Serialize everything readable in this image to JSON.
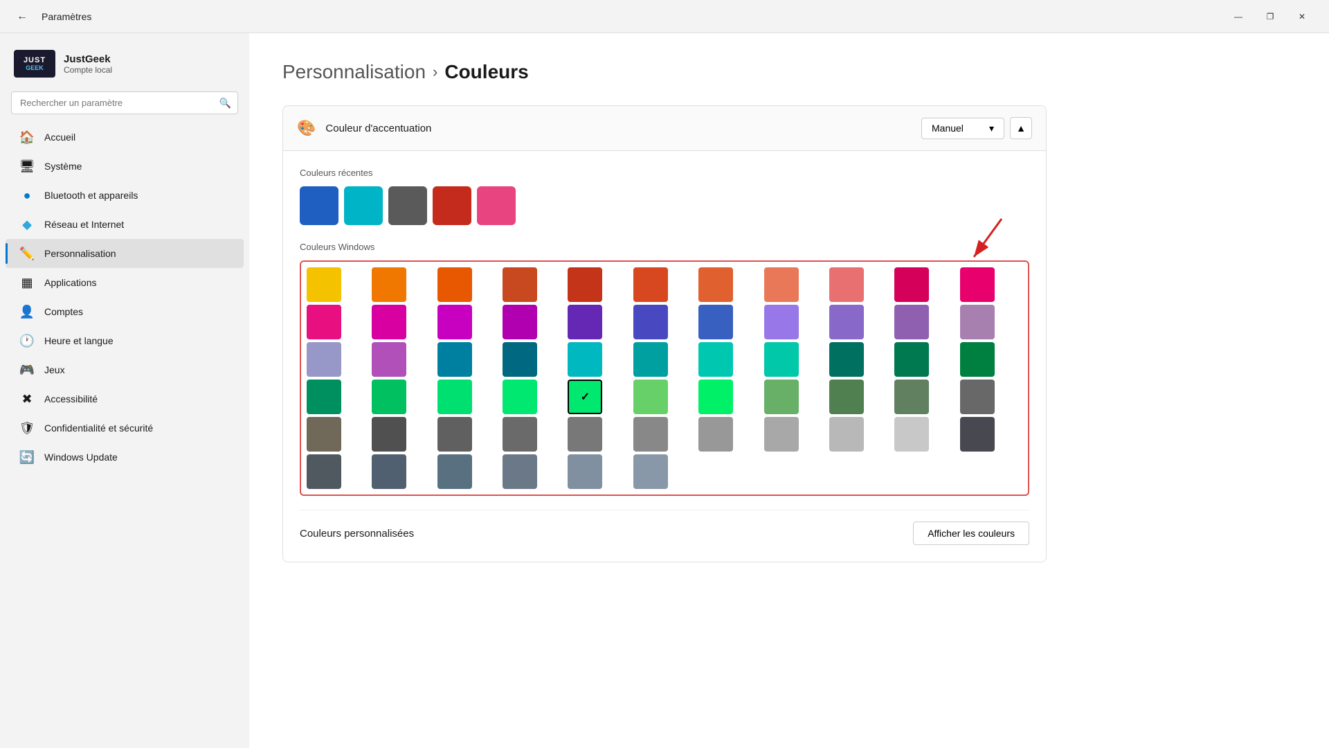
{
  "titlebar": {
    "title": "Paramètres",
    "minimize_label": "—",
    "maximize_label": "❐",
    "close_label": "✕"
  },
  "sidebar": {
    "profile": {
      "username": "JustGeek",
      "account_type": "Compte local",
      "logo_line1": "JUST",
      "logo_line2": "GEEK"
    },
    "search": {
      "placeholder": "Rechercher un paramètre"
    },
    "items": [
      {
        "id": "accueil",
        "label": "Accueil",
        "icon": "🏠"
      },
      {
        "id": "systeme",
        "label": "Système",
        "icon": "🖥"
      },
      {
        "id": "bluetooth",
        "label": "Bluetooth et appareils",
        "icon": "🔵"
      },
      {
        "id": "reseau",
        "label": "Réseau et Internet",
        "icon": "💎"
      },
      {
        "id": "personnalisation",
        "label": "Personnalisation",
        "icon": "✏️",
        "active": true
      },
      {
        "id": "applications",
        "label": "Applications",
        "icon": "▦"
      },
      {
        "id": "comptes",
        "label": "Comptes",
        "icon": "👤"
      },
      {
        "id": "heure",
        "label": "Heure et langue",
        "icon": "🕐"
      },
      {
        "id": "jeux",
        "label": "Jeux",
        "icon": "🎮"
      },
      {
        "id": "accessibilite",
        "label": "Accessibilité",
        "icon": "♿"
      },
      {
        "id": "confidentialite",
        "label": "Confidentialité et sécurité",
        "icon": "🛡"
      },
      {
        "id": "windows-update",
        "label": "Windows Update",
        "icon": "🔄"
      }
    ]
  },
  "breadcrumb": {
    "parent": "Personnalisation",
    "separator": "›",
    "current": "Couleurs"
  },
  "accent_section": {
    "icon": "🎨",
    "title": "Couleur d'accentuation",
    "dropdown_value": "Manuel",
    "dropdown_arrow": "▾",
    "collapse_icon": "▲"
  },
  "recent_colors": {
    "label": "Couleurs récentes",
    "swatches": [
      "#1e5fc1",
      "#00b4c8",
      "#5a5a5a",
      "#c42b1c",
      "#e84580"
    ]
  },
  "windows_colors": {
    "label": "Couleurs Windows",
    "selected_index": 37,
    "colors": [
      "#f5c000",
      "#f07800",
      "#e85800",
      "#c04820",
      "#c43418",
      "#d84820",
      "#e06030",
      "#e87858",
      "#e87870",
      "#d4005a",
      "#e8006c",
      "#e81080",
      "#d800a0",
      "#c800c0",
      "#b000b0",
      "#6428b4",
      "#4848c0",
      "#3860c0",
      "#7858c8",
      "#8060b8",
      "#7060a8",
      "#8870b0",
      "#9898c8",
      "#a840b0",
      "#0080a0",
      "#006880",
      "#008898",
      "#00a0a0",
      "#00c8c0",
      "#00c8a8",
      "#007060",
      "#007860",
      "#008048",
      "#009060",
      "#00c060",
      "#00e000",
      "#00c850",
      "#00d070",
      "#00e870",
      "#50e870",
      "#68d068",
      "#60c060",
      "#68b068",
      "#505050",
      "#606060",
      "#6a6a6a",
      "#787878",
      "#888888",
      "#989898",
      "#a8a8a8",
      "#b8b8b8",
      "#484850",
      "#505860",
      "#506070",
      "#587080",
      "#6a7888",
      "#8090a0",
      "#386838",
      "#485848",
      "#586858",
      "#686868",
      "#706858",
      "#787060",
      "#887860",
      "#505040",
      "#807050",
      "#887860"
    ]
  },
  "custom_colors": {
    "label": "Couleurs personnalisées",
    "button_label": "Afficher les couleurs"
  }
}
